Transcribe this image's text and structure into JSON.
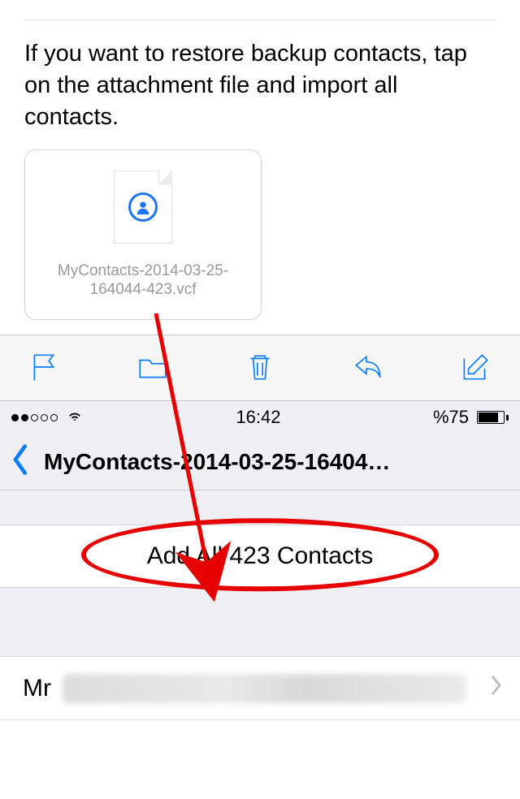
{
  "instruction": "If you want to restore backup contacts, tap on the attachment file and import all contacts.",
  "attachment": {
    "filename": "MyContacts-2014-03-25-164044-423.vcf"
  },
  "toolbar_icons": {
    "flag": "flag-icon",
    "folder": "folder-icon",
    "trash": "trash-icon",
    "reply": "reply-icon",
    "compose": "compose-icon"
  },
  "status_bar": {
    "time": "16:42",
    "battery_text": "%75"
  },
  "nav": {
    "title": "MyContacts-2014-03-25-16404…"
  },
  "add_button": {
    "label": "Add All 423 Contacts"
  },
  "contact_row": {
    "prefix": "Mr"
  }
}
